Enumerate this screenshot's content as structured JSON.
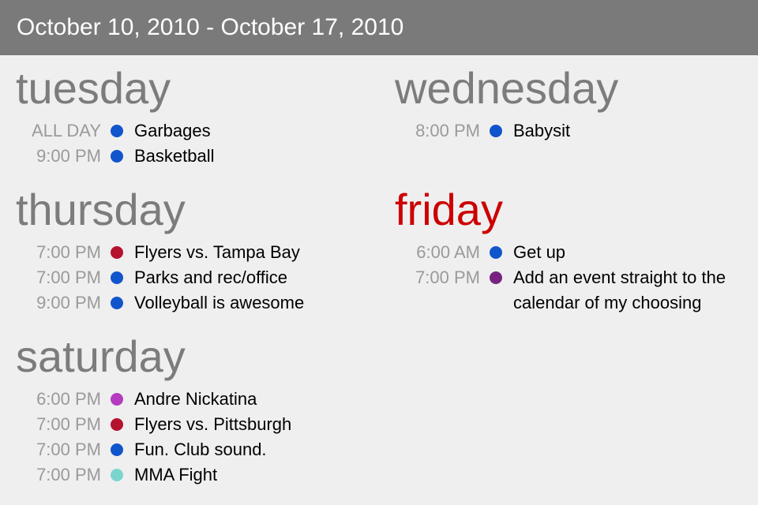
{
  "header": {
    "date_range": "October 10, 2010 - October 17, 2010"
  },
  "colors": {
    "blue": "#1155cc",
    "red": "#b5122e",
    "magenta": "#b43cbf",
    "teal": "#7bd5cf",
    "purple": "#77237f",
    "today_red": "#cc0000"
  },
  "days": {
    "tuesday": {
      "name": "tuesday",
      "events": [
        {
          "time": "ALL DAY",
          "title": "Garbages",
          "calendar_color": "#1155cc"
        },
        {
          "time": "9:00 PM",
          "title": "Basketball",
          "calendar_color": "#1155cc"
        }
      ]
    },
    "wednesday": {
      "name": "wednesday",
      "events": [
        {
          "time": "8:00 PM",
          "title": "Babysit",
          "calendar_color": "#1155cc"
        }
      ]
    },
    "thursday": {
      "name": "thursday",
      "events": [
        {
          "time": "7:00 PM",
          "title": "Flyers vs. Tampa Bay",
          "calendar_color": "#b5122e"
        },
        {
          "time": "7:00 PM",
          "title": "Parks and rec/office",
          "calendar_color": "#1155cc"
        },
        {
          "time": "9:00 PM",
          "title": "Volleyball is awesome",
          "calendar_color": "#1155cc"
        }
      ]
    },
    "friday": {
      "name": "friday",
      "is_today": true,
      "events": [
        {
          "time": "6:00 AM",
          "title": "Get up",
          "calendar_color": "#1155cc"
        },
        {
          "time": "7:00 PM",
          "title_line1": "Add an event straight to the",
          "title_line2": "calendar of my choosing",
          "calendar_color": "#77237f"
        }
      ]
    },
    "saturday": {
      "name": "saturday",
      "events": [
        {
          "time": "6:00 PM",
          "title": "Andre Nickatina",
          "calendar_color": "#b43cbf"
        },
        {
          "time": "7:00 PM",
          "title": "Flyers vs. Pittsburgh",
          "calendar_color": "#b5122e"
        },
        {
          "time": "7:00 PM",
          "title": "Fun. Club sound.",
          "calendar_color": "#1155cc"
        },
        {
          "time": "7:00 PM",
          "title": "MMA Fight",
          "calendar_color": "#7bd5cf"
        }
      ]
    }
  }
}
